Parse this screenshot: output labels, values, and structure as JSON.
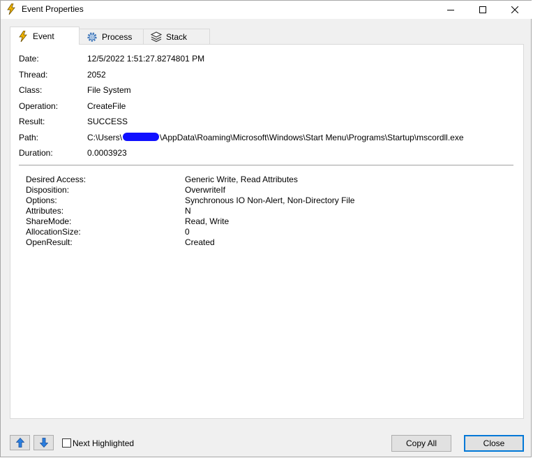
{
  "window": {
    "title": "Event Properties"
  },
  "tabs": [
    {
      "label": "Event",
      "icon": "lightning-icon"
    },
    {
      "label": "Process",
      "icon": "gear-icon"
    },
    {
      "label": "Stack",
      "icon": "layers-icon"
    }
  ],
  "event": {
    "fields": [
      {
        "label": "Date:",
        "value": "12/5/2022 1:51:27.8274801 PM"
      },
      {
        "label": "Thread:",
        "value": "2052"
      },
      {
        "label": "Class:",
        "value": "File System"
      },
      {
        "label": "Operation:",
        "value": "CreateFile"
      },
      {
        "label": "Result:",
        "value": "SUCCESS"
      },
      {
        "label": "Path:",
        "value_prefix": "C:\\Users\\",
        "value_suffix": "\\AppData\\Roaming\\Microsoft\\Windows\\Start Menu\\Programs\\Startup\\mscordll.exe"
      },
      {
        "label": "Duration:",
        "value": "0.0003923"
      }
    ],
    "details": [
      {
        "label": "Desired Access:",
        "value": "Generic Write, Read Attributes"
      },
      {
        "label": "Disposition:",
        "value": "OverwriteIf"
      },
      {
        "label": "Options:",
        "value": "Synchronous IO Non-Alert, Non-Directory File"
      },
      {
        "label": "Attributes:",
        "value": "N"
      },
      {
        "label": "ShareMode:",
        "value": "Read, Write"
      },
      {
        "label": "AllocationSize:",
        "value": "0"
      },
      {
        "label": "OpenResult:",
        "value": "Created"
      }
    ]
  },
  "footer": {
    "next_highlighted_label": "Next Highlighted",
    "copy_all_label": "Copy All",
    "close_label": "Close"
  },
  "colors": {
    "accent": "#0078d7",
    "redaction": "#1010ff",
    "lightning": "#f0b400",
    "arrow": "#2a7fe0"
  }
}
